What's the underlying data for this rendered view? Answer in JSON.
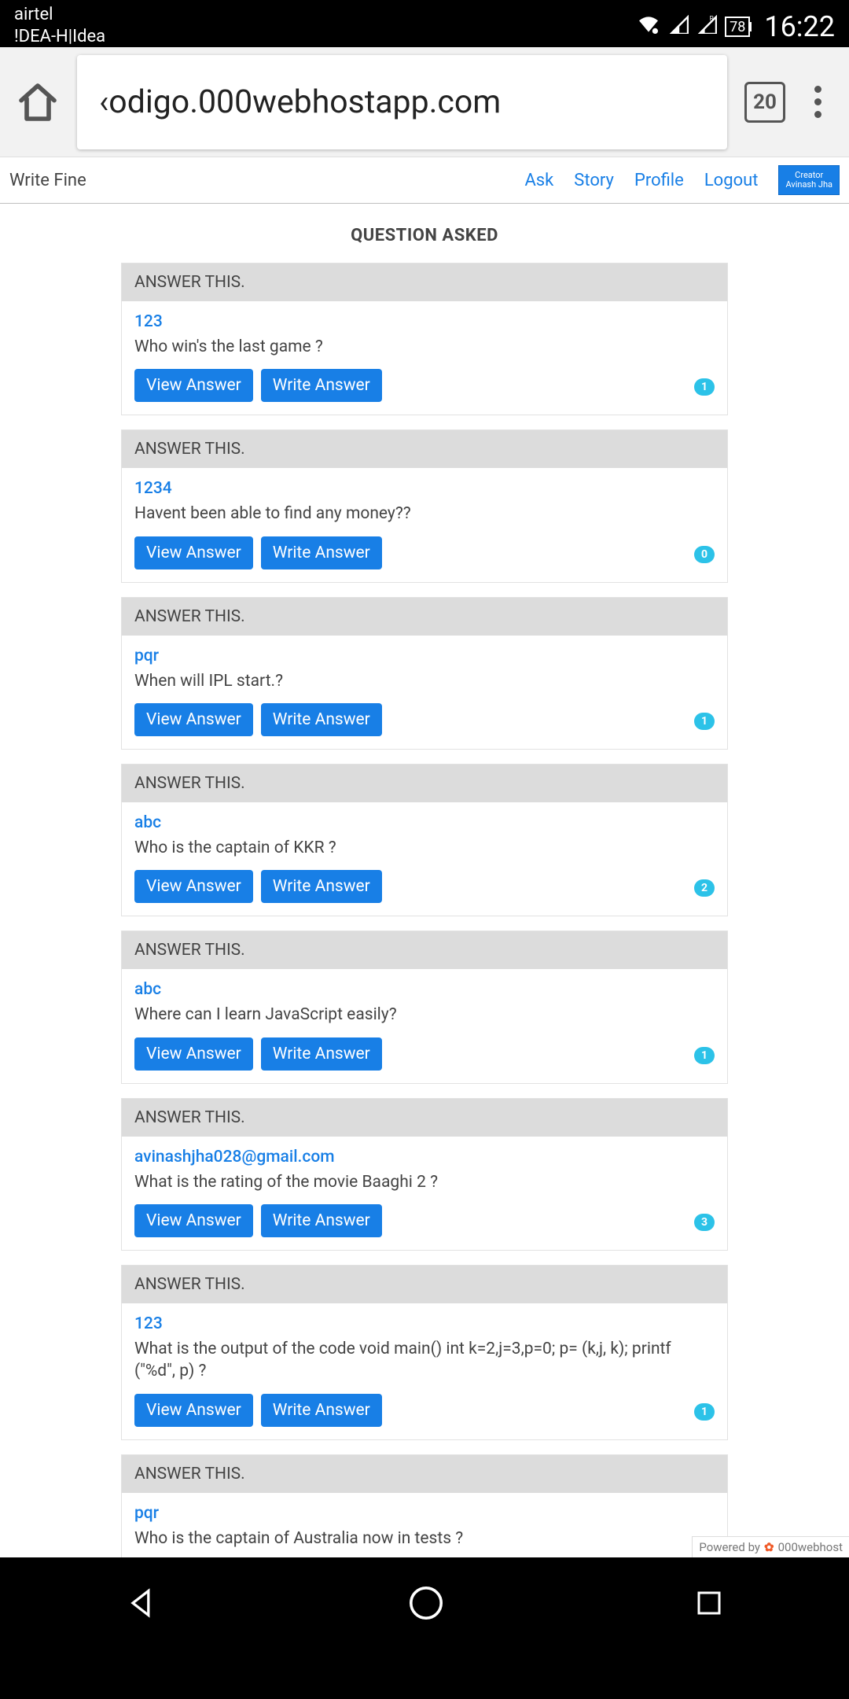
{
  "status": {
    "carrier1": "airtel",
    "carrier2": "!DEA-H|Idea",
    "battery": "78",
    "time": "16:22"
  },
  "browser": {
    "url": "‹odigo.000webhostapp.com",
    "tab_count": "20"
  },
  "header": {
    "brand": "Write Fine",
    "links": {
      "ask": "Ask",
      "story": "Story",
      "profile": "Profile",
      "logout": "Logout"
    },
    "creator_label": "Creator",
    "creator_name": "Avinash Jha"
  },
  "page_title": "QUESTION ASKED",
  "card_header": "ANSWER THIS.",
  "buttons": {
    "view": "View Answer",
    "write": "Write Answer"
  },
  "questions": [
    {
      "user": "123",
      "text": "Who win's the last game ?",
      "count": "1"
    },
    {
      "user": "1234",
      "text": "Havent been able to find any money??",
      "count": "0"
    },
    {
      "user": "pqr",
      "text": "When will IPL start.?",
      "count": "1"
    },
    {
      "user": "abc",
      "text": "Who is the captain of KKR ?",
      "count": "2"
    },
    {
      "user": "abc",
      "text": "Where can I learn JavaScript easily?",
      "count": "1"
    },
    {
      "user": "avinashjha028@gmail.com",
      "text": "What is the rating of the movie Baaghi 2 ?",
      "count": "3"
    },
    {
      "user": "123",
      "text": "What is the output of the code void main() int k=2,j=3,p=0; p= (k,j, k); printf (\"%d\", p) ?",
      "count": "1"
    },
    {
      "user": "pqr",
      "text": "Who is the captain of Australia now in tests ?",
      "count": ""
    }
  ],
  "powered": {
    "prefix": "Powered by",
    "brand": "000webhost"
  }
}
